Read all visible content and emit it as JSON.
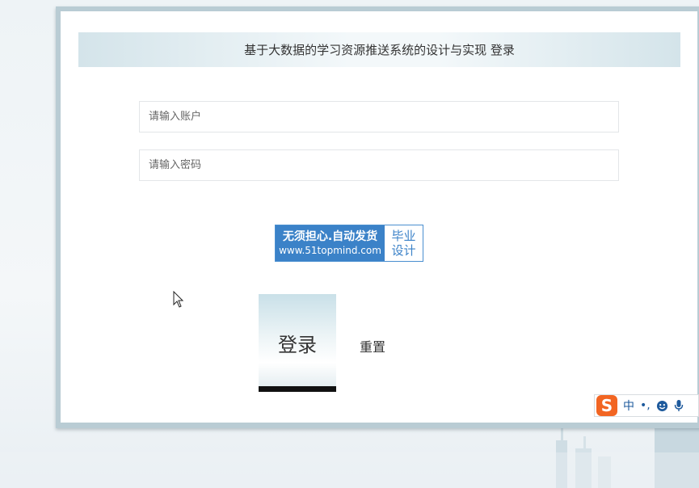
{
  "login": {
    "title": "基于大数据的学习资源推送系统的设计与实现 登录",
    "account_placeholder": "请输入账户",
    "password_placeholder": "请输入密码",
    "login_label": "登录",
    "reset_label": "重置"
  },
  "watermark": {
    "main_text": "无须担心.自动发货",
    "url_text": "www.51topmind.com",
    "side_line1": "毕业",
    "side_line2": "设计"
  },
  "ime_toolbar": {
    "logo": "S",
    "mode_label": "中",
    "punct_label": "•,",
    "emoji_icon": "smile-icon",
    "mic_icon": "microphone-icon"
  },
  "colors": {
    "panel_border": "#b9ccd4",
    "watermark_blue": "#3b82c8",
    "ime_orange": "#f26522"
  }
}
